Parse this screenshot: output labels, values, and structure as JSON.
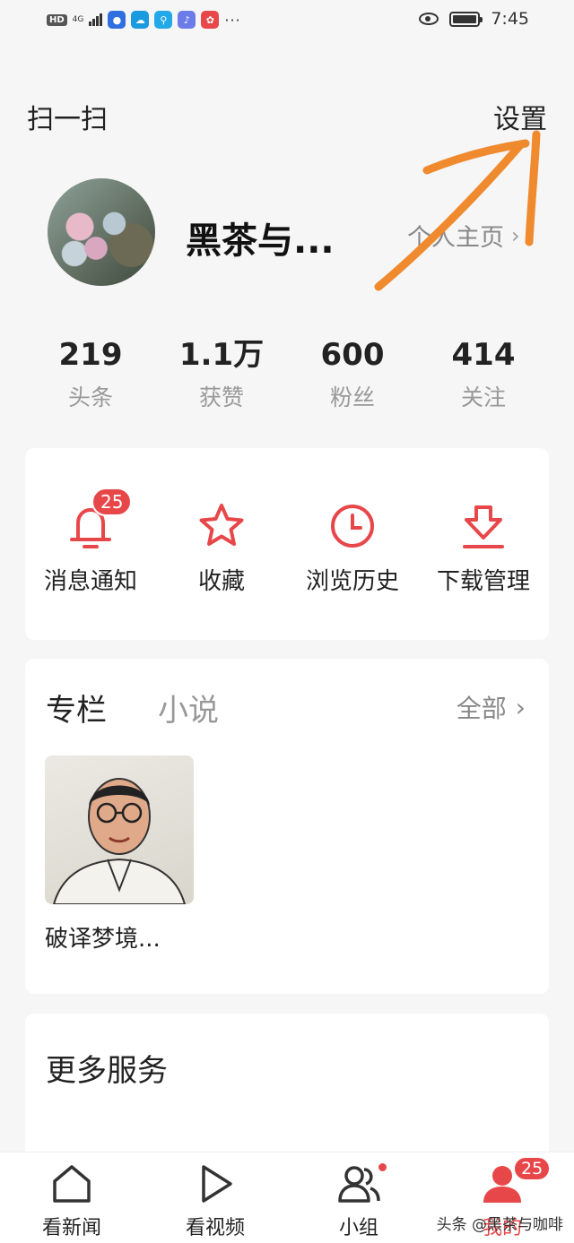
{
  "status_bar": {
    "hd": "HD",
    "signal": "4G",
    "time": "7:45",
    "app_icons": [
      "bulb-app-icon",
      "weather-app-icon",
      "search-app-icon",
      "music-app-icon",
      "huawei-app-icon"
    ],
    "more": "···"
  },
  "top": {
    "scan_label": "扫一扫",
    "settings_label": "设置"
  },
  "profile": {
    "username": "黑茶与...",
    "homepage_label": "个人主页",
    "homepage_chevron": "›"
  },
  "stats": [
    {
      "value": "219",
      "label": "头条"
    },
    {
      "value": "1.1万",
      "label": "获赞"
    },
    {
      "value": "600",
      "label": "粉丝"
    },
    {
      "value": "414",
      "label": "关注"
    }
  ],
  "tools": [
    {
      "label": "消息通知",
      "icon": "bell-icon",
      "badge": "25"
    },
    {
      "label": "收藏",
      "icon": "star-icon"
    },
    {
      "label": "浏览历史",
      "icon": "clock-icon"
    },
    {
      "label": "下载管理",
      "icon": "download-icon"
    }
  ],
  "column": {
    "tab_active": "专栏",
    "tab_novel": "小说",
    "all_label": "全部",
    "all_chevron": "›",
    "book_title": "破译梦境..."
  },
  "more_services": {
    "title": "更多服务"
  },
  "bottom_nav": [
    {
      "label": "看新闻",
      "icon": "home-icon"
    },
    {
      "label": "看视频",
      "icon": "play-icon"
    },
    {
      "label": "小组",
      "icon": "group-icon"
    },
    {
      "label": "我的",
      "icon": "user-icon",
      "badge": "25"
    }
  ],
  "watermark": "头条 @黑茶与咖啡",
  "colors": {
    "accent": "#e8474a",
    "annotation": "#f08a2e"
  }
}
